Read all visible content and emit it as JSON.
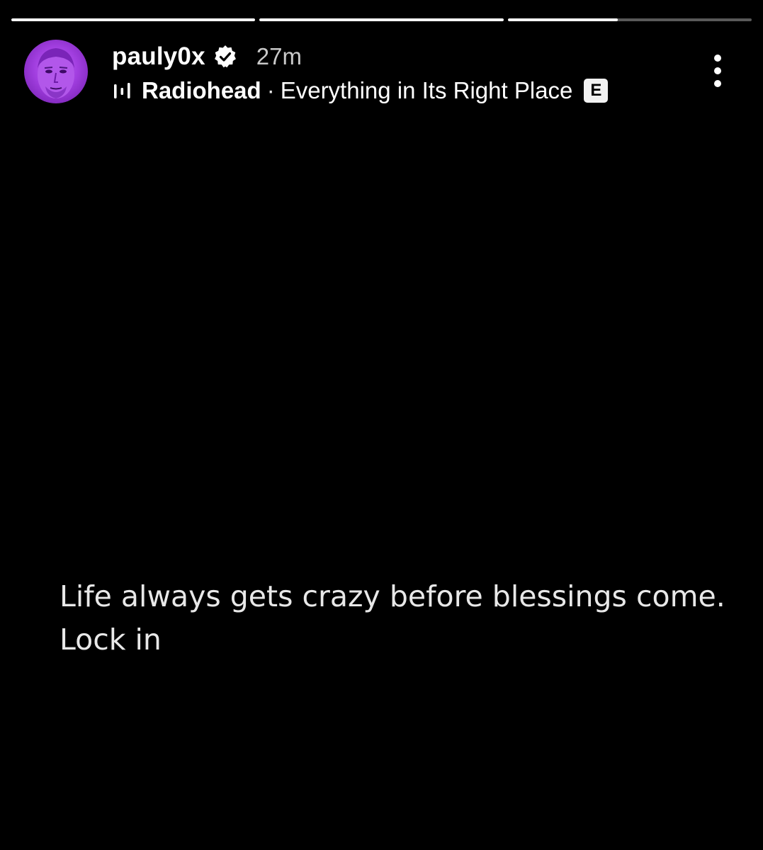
{
  "story": {
    "progress": [
      1,
      1,
      0.45
    ]
  },
  "header": {
    "username": "pauly0x",
    "verified_icon": "verified-badge-icon",
    "time": "27m",
    "music": {
      "icon": "audio-bars-icon",
      "artist": "Radiohead",
      "separator": "·",
      "song": "Everything in Its Right Place",
      "explicit_label": "E"
    },
    "more_icon": "more-vertical-icon"
  },
  "caption": {
    "line1": "Life always gets crazy before blessings come.",
    "line2": "Lock in"
  },
  "colors": {
    "background": "#000000",
    "avatar_tint": "#a23fe0"
  }
}
